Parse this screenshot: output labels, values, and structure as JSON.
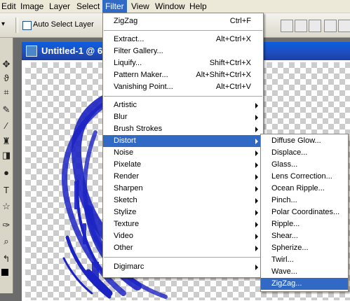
{
  "menubar": {
    "items": [
      "Edit",
      "Image",
      "Layer",
      "Select",
      "Filter",
      "View",
      "Window",
      "Help"
    ],
    "active": "Filter"
  },
  "options_bar": {
    "auto_select_label": "Auto Select Layer",
    "auto_select_checked": false
  },
  "document": {
    "title": "Untitled-1 @ 6",
    "artwork_color": "#1c23c3"
  },
  "filter_menu": {
    "last_filter": {
      "label": "ZigZag",
      "shortcut": "Ctrl+F"
    },
    "group_a": [
      {
        "label": "Extract...",
        "shortcut": "Alt+Ctrl+X"
      },
      {
        "label": "Filter Gallery...",
        "shortcut": ""
      },
      {
        "label": "Liquify...",
        "shortcut": "Shift+Ctrl+X"
      },
      {
        "label": "Pattern Maker...",
        "shortcut": "Alt+Shift+Ctrl+X"
      },
      {
        "label": "Vanishing Point...",
        "shortcut": "Alt+Ctrl+V"
      }
    ],
    "submenus": [
      "Artistic",
      "Blur",
      "Brush Strokes",
      "Distort",
      "Noise",
      "Pixelate",
      "Render",
      "Sharpen",
      "Sketch",
      "Stylize",
      "Texture",
      "Video",
      "Other"
    ],
    "highlighted": "Distort",
    "plugins": [
      "Digimarc"
    ]
  },
  "distort_menu": {
    "items": [
      "Diffuse Glow...",
      "Displace...",
      "Glass...",
      "Lens Correction...",
      "Ocean Ripple...",
      "Pinch...",
      "Polar Coordinates...",
      "Ripple...",
      "Shear...",
      "Spherize...",
      "Twirl...",
      "Wave...",
      "ZigZag..."
    ],
    "highlighted": "ZigZag..."
  },
  "colors": {
    "menu_highlight": "#316ac5",
    "menubar_bg": "#ece9d8",
    "titlebar": "#1f4dbd"
  }
}
